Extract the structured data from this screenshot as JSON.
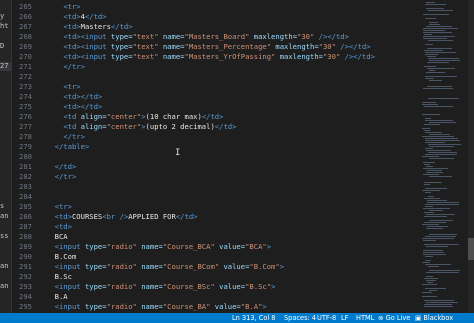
{
  "sidebar_fragments": [
    "",
    "y",
    "ht",
    "",
    "D",
    "",
    "27",
    "",
    "",
    "",
    "",
    "",
    "",
    "",
    "",
    "",
    "",
    "",
    "",
    "",
    "s",
    "an",
    "",
    "ss",
    "",
    "",
    "an",
    "",
    "an",
    "",
    ""
  ],
  "line_numbers": [
    "265",
    "266",
    "267",
    "268",
    "269",
    "270",
    "271",
    "272",
    "273",
    "274",
    "275",
    "276",
    "277",
    "278",
    "279",
    "280",
    "281",
    "282",
    "283",
    "284",
    "285",
    "286",
    "287",
    "288",
    "289",
    "290",
    "291",
    "292",
    "293",
    "294",
    "295"
  ],
  "code_lines": [
    [
      {
        "t": "    ",
        "c": "tx"
      },
      {
        "t": "<tr>",
        "c": "tg"
      }
    ],
    [
      {
        "t": "    ",
        "c": "tx"
      },
      {
        "t": "<td>",
        "c": "tg"
      },
      {
        "t": "4",
        "c": "tx"
      },
      {
        "t": "</td>",
        "c": "tg"
      }
    ],
    [
      {
        "t": "    ",
        "c": "tx"
      },
      {
        "t": "<td>",
        "c": "tg"
      },
      {
        "t": "Masters",
        "c": "tx"
      },
      {
        "t": "</td>",
        "c": "tg"
      }
    ],
    [
      {
        "t": "    ",
        "c": "tx"
      },
      {
        "t": "<td><input ",
        "c": "tg"
      },
      {
        "t": "type=",
        "c": "at"
      },
      {
        "t": "\"text\" ",
        "c": "st"
      },
      {
        "t": "name=",
        "c": "at"
      },
      {
        "t": "\"Masters_Board\" ",
        "c": "st"
      },
      {
        "t": "maxlength=",
        "c": "at"
      },
      {
        "t": "\"30\"",
        "c": "st"
      },
      {
        "t": " /></td>",
        "c": "tg"
      }
    ],
    [
      {
        "t": "    ",
        "c": "tx"
      },
      {
        "t": "<td><input ",
        "c": "tg"
      },
      {
        "t": "type=",
        "c": "at"
      },
      {
        "t": "\"text\" ",
        "c": "st"
      },
      {
        "t": "name=",
        "c": "at"
      },
      {
        "t": "\"Masters_Percentage\" ",
        "c": "st"
      },
      {
        "t": "maxlength=",
        "c": "at"
      },
      {
        "t": "\"30\"",
        "c": "st"
      },
      {
        "t": " /></td>",
        "c": "tg"
      }
    ],
    [
      {
        "t": "    ",
        "c": "tx"
      },
      {
        "t": "<td><input ",
        "c": "tg"
      },
      {
        "t": "type=",
        "c": "at"
      },
      {
        "t": "\"text\" ",
        "c": "st"
      },
      {
        "t": "name=",
        "c": "at"
      },
      {
        "t": "\"Masters_YrOfPassing\" ",
        "c": "st"
      },
      {
        "t": "maxlength=",
        "c": "at"
      },
      {
        "t": "\"30\"",
        "c": "st"
      },
      {
        "t": " /></td>",
        "c": "tg"
      }
    ],
    [
      {
        "t": "    ",
        "c": "tx"
      },
      {
        "t": "</tr>",
        "c": "tg"
      }
    ],
    [],
    [
      {
        "t": "    ",
        "c": "tx"
      },
      {
        "t": "<tr>",
        "c": "tg"
      }
    ],
    [
      {
        "t": "    ",
        "c": "tx"
      },
      {
        "t": "<td></td>",
        "c": "tg"
      }
    ],
    [
      {
        "t": "    ",
        "c": "tx"
      },
      {
        "t": "<td></td>",
        "c": "tg"
      }
    ],
    [
      {
        "t": "    ",
        "c": "tx"
      },
      {
        "t": "<td ",
        "c": "tg"
      },
      {
        "t": "align=",
        "c": "at"
      },
      {
        "t": "\"center\"",
        "c": "st"
      },
      {
        "t": ">",
        "c": "tg"
      },
      {
        "t": "(10 char max)",
        "c": "tx"
      },
      {
        "t": "</td>",
        "c": "tg"
      }
    ],
    [
      {
        "t": "    ",
        "c": "tx"
      },
      {
        "t": "<td ",
        "c": "tg"
      },
      {
        "t": "align=",
        "c": "at"
      },
      {
        "t": "\"center\"",
        "c": "st"
      },
      {
        "t": ">",
        "c": "tg"
      },
      {
        "t": "(upto 2 decimal)",
        "c": "tx"
      },
      {
        "t": "</td>",
        "c": "tg"
      }
    ],
    [
      {
        "t": "    ",
        "c": "tx"
      },
      {
        "t": "</tr>",
        "c": "tg"
      }
    ],
    [
      {
        "t": "  ",
        "c": "tx"
      },
      {
        "t": "</table>",
        "c": "tg"
      }
    ],
    [],
    [
      {
        "t": "  ",
        "c": "tx"
      },
      {
        "t": "</td>",
        "c": "tg"
      }
    ],
    [
      {
        "t": "  ",
        "c": "tx"
      },
      {
        "t": "</tr>",
        "c": "tg"
      }
    ],
    [],
    [],
    [
      {
        "t": "  ",
        "c": "tx"
      },
      {
        "t": "<tr>",
        "c": "tg"
      }
    ],
    [
      {
        "t": "  ",
        "c": "tx"
      },
      {
        "t": "<td>",
        "c": "tg"
      },
      {
        "t": "COURSES",
        "c": "tx"
      },
      {
        "t": "<br />",
        "c": "tg"
      },
      {
        "t": "APPLIED FOR",
        "c": "tx"
      },
      {
        "t": "</td>",
        "c": "tg"
      }
    ],
    [
      {
        "t": "  ",
        "c": "tx"
      },
      {
        "t": "<td>",
        "c": "tg"
      }
    ],
    [
      {
        "t": "  BCA",
        "c": "tx"
      }
    ],
    [
      {
        "t": "  ",
        "c": "tx"
      },
      {
        "t": "<input ",
        "c": "tg"
      },
      {
        "t": "type=",
        "c": "at"
      },
      {
        "t": "\"radio\" ",
        "c": "st"
      },
      {
        "t": "name=",
        "c": "at"
      },
      {
        "t": "\"Course_BCA\" ",
        "c": "st"
      },
      {
        "t": "value=",
        "c": "at"
      },
      {
        "t": "\"BCA\"",
        "c": "st"
      },
      {
        "t": ">",
        "c": "tg"
      }
    ],
    [
      {
        "t": "  B.Com",
        "c": "tx"
      }
    ],
    [
      {
        "t": "  ",
        "c": "tx"
      },
      {
        "t": "<input ",
        "c": "tg"
      },
      {
        "t": "type=",
        "c": "at"
      },
      {
        "t": "\"radio\" ",
        "c": "st"
      },
      {
        "t": "name=",
        "c": "at"
      },
      {
        "t": "\"Course_BCom\" ",
        "c": "st"
      },
      {
        "t": "value=",
        "c": "at"
      },
      {
        "t": "\"B.Com\"",
        "c": "st"
      },
      {
        "t": ">",
        "c": "tg"
      }
    ],
    [
      {
        "t": "  B.Sc",
        "c": "tx"
      }
    ],
    [
      {
        "t": "  ",
        "c": "tx"
      },
      {
        "t": "<input ",
        "c": "tg"
      },
      {
        "t": "type=",
        "c": "at"
      },
      {
        "t": "\"radio\" ",
        "c": "st"
      },
      {
        "t": "name=",
        "c": "at"
      },
      {
        "t": "\"Course_BSc\" ",
        "c": "st"
      },
      {
        "t": "value=",
        "c": "at"
      },
      {
        "t": "\"B.Sc\"",
        "c": "st"
      },
      {
        "t": ">",
        "c": "tg"
      }
    ],
    [
      {
        "t": "  B.A",
        "c": "tx"
      }
    ],
    [
      {
        "t": "  ",
        "c": "tx"
      },
      {
        "t": "<input ",
        "c": "tg"
      },
      {
        "t": "type=",
        "c": "at"
      },
      {
        "t": "\"radio\" ",
        "c": "st"
      },
      {
        "t": "name=",
        "c": "at"
      },
      {
        "t": "\"Course_BA\" ",
        "c": "st"
      },
      {
        "t": "value=",
        "c": "at"
      },
      {
        "t": "\"B.A\"",
        "c": "st"
      },
      {
        "t": ">",
        "c": "tg"
      }
    ]
  ],
  "status_bar": {
    "position": "Ln 313, Col 8",
    "spaces": "Spaces: 4",
    "encoding": "UTF-8",
    "eol": "LF",
    "language": "HTML",
    "go_live": "Go Live",
    "extension": "Blackbox"
  },
  "colors": {
    "tag": "#5b9bd5",
    "attribute": "#9cdcfe",
    "string": "#ce9178",
    "text": "#e6e6e6",
    "status_bar": "#007acc",
    "background": "#1e1e1e"
  }
}
